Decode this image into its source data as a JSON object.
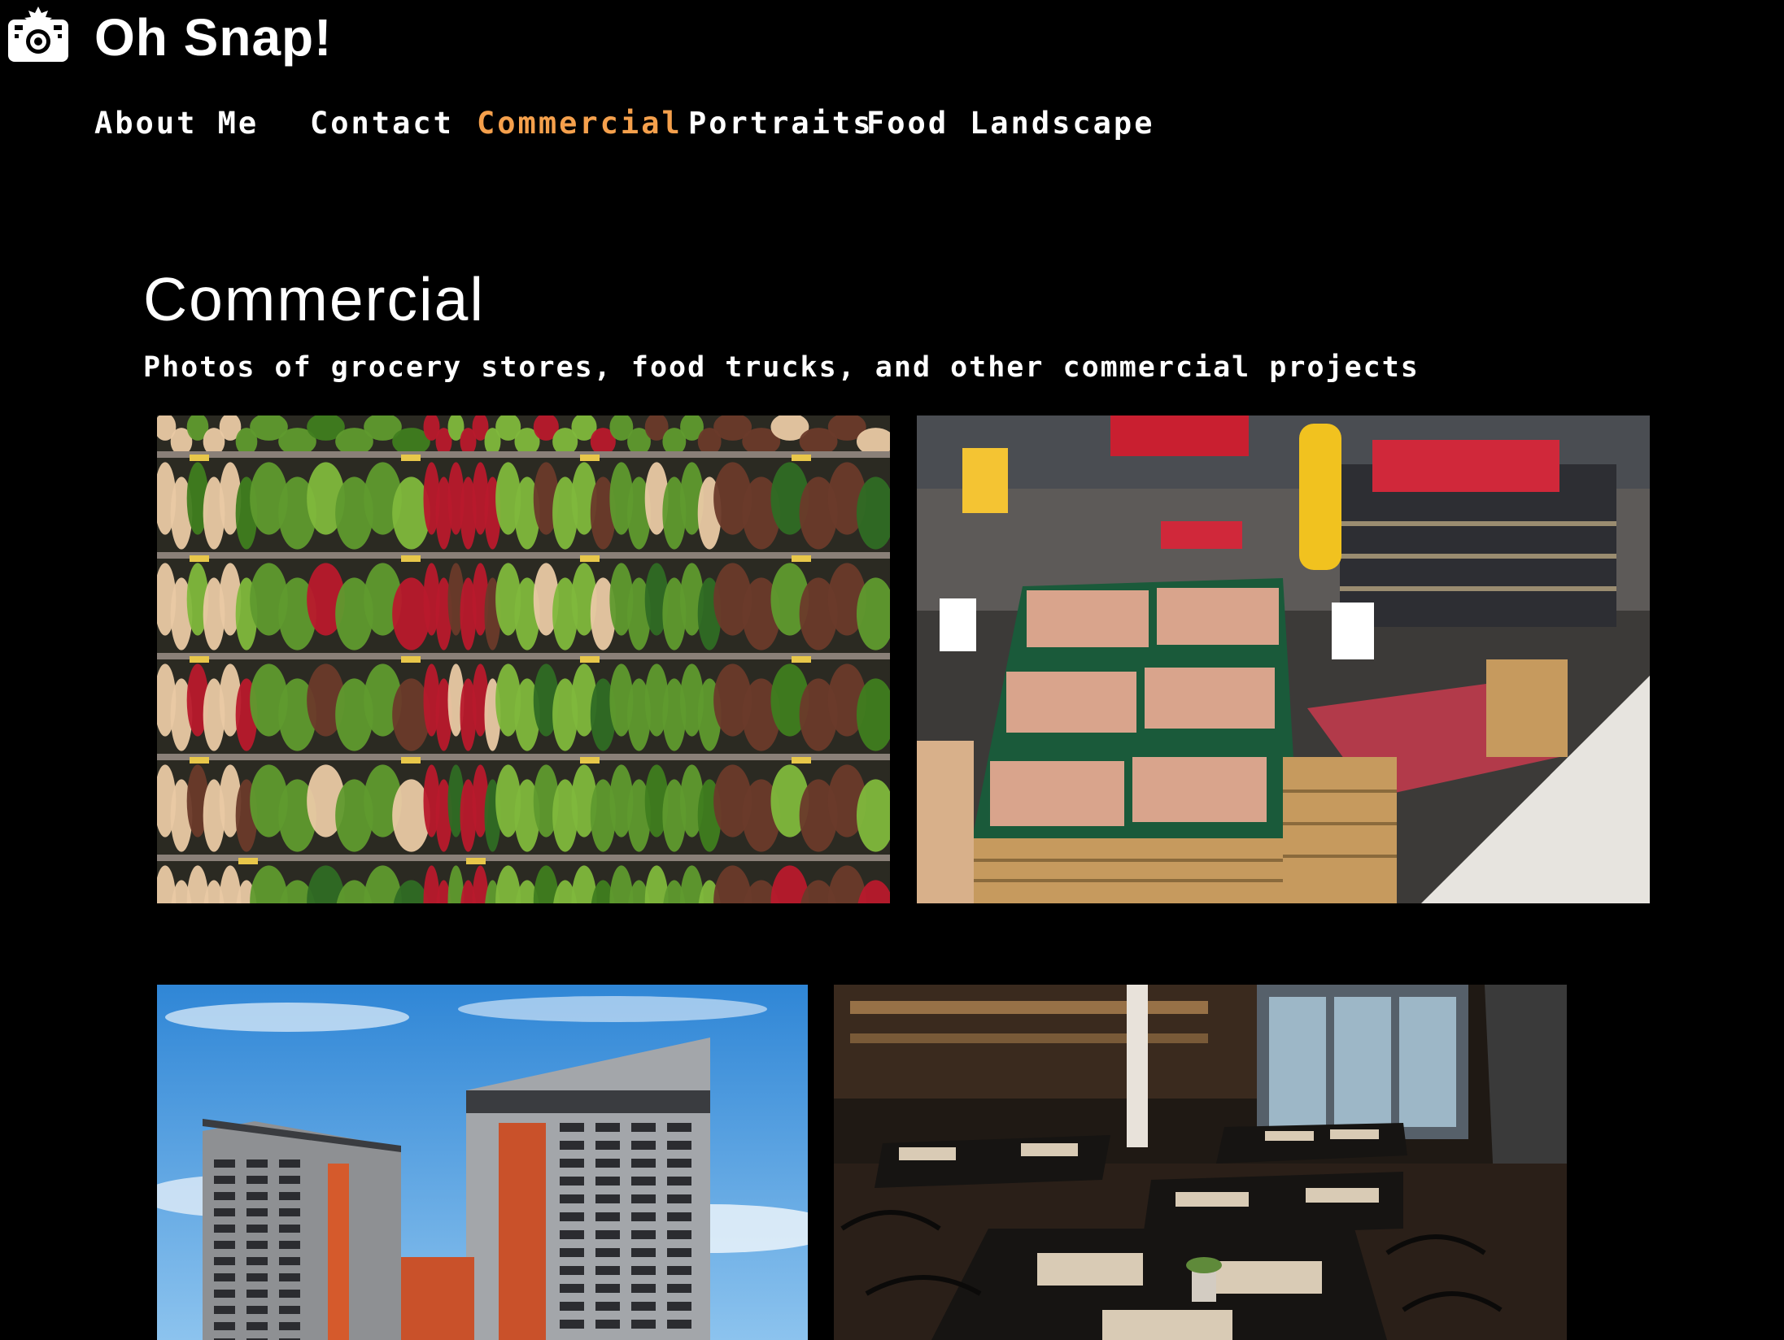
{
  "header": {
    "brand": "Oh Snap!",
    "logo_icon": "camera-icon"
  },
  "nav": {
    "items": [
      {
        "label": "About Me",
        "active": false
      },
      {
        "label": "Contact",
        "active": false
      },
      {
        "label": "Commercial",
        "active": true
      },
      {
        "label": "Portraits",
        "active": false
      },
      {
        "label": "Food",
        "active": false
      },
      {
        "label": "Landscape",
        "active": false
      }
    ],
    "active_color": "#f5a04c"
  },
  "main": {
    "title": "Commercial",
    "subtitle": "Photos of grocery stores, food trucks, and other commercial projects"
  },
  "photos": [
    {
      "subject": "produce-shelves-photo"
    },
    {
      "subject": "supermarket-aisle-photo"
    },
    {
      "subject": "apartment-buildings-photo"
    },
    {
      "subject": "restaurant-dining-room-photo"
    }
  ],
  "colors": {
    "background": "#000000",
    "text": "#ffffff",
    "accent": "#f5a04c"
  }
}
